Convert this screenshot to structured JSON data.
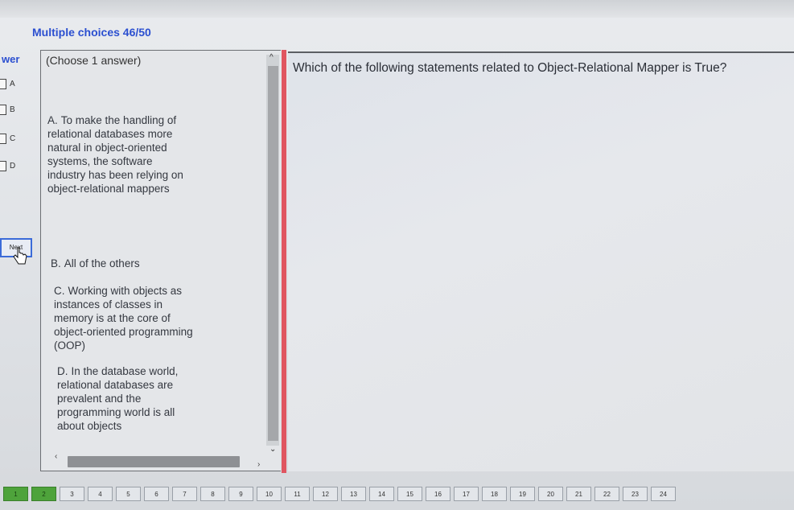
{
  "header": {
    "title": "Multiple choices 46/50"
  },
  "answer_sidebar": {
    "label": "wer",
    "options": [
      {
        "letter": "A"
      },
      {
        "letter": "B"
      },
      {
        "letter": "C"
      },
      {
        "letter": "D"
      }
    ],
    "next_button": "Next"
  },
  "answers_panel": {
    "instruction": "(Choose 1 answer)",
    "answers": [
      {
        "letter": "A.",
        "text": "To make the handling of relational databases more natural in object-oriented systems, the software industry has been relying on object-relational mappers"
      },
      {
        "letter": "B.",
        "text": "All of the others"
      },
      {
        "letter": "C.",
        "text": "Working with objects as instances of classes in memory is at the core of object-oriented programming (OOP)"
      },
      {
        "letter": "D.",
        "text": "In the database world, relational databases are prevalent and the programming world is all about objects"
      }
    ]
  },
  "question_panel": {
    "question": "Which of the following statements related to Object-Relational Mapper is True?"
  },
  "pager": {
    "pages": [
      "1",
      "2",
      "3",
      "4",
      "5",
      "6",
      "7",
      "8",
      "9",
      "10",
      "11",
      "12",
      "13",
      "14",
      "15",
      "16",
      "17",
      "18",
      "19",
      "20",
      "21",
      "22",
      "23",
      "24"
    ],
    "answered": [
      1,
      2
    ]
  },
  "colors": {
    "accent": "#2b4fd0",
    "divider": "#e05560",
    "answered": "#4ea33b"
  }
}
